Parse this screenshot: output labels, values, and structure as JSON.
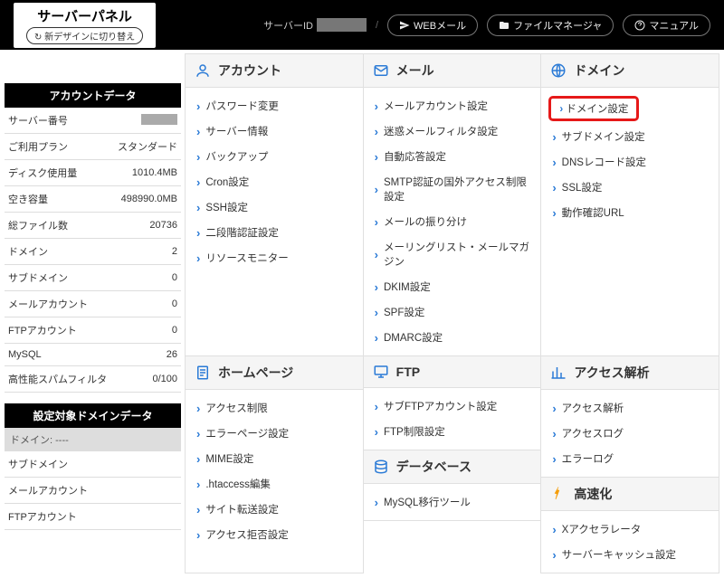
{
  "header": {
    "logo_title": "サーバーパネル",
    "switch_design": "新デザインに切り替え",
    "server_id_label": "サーバーID",
    "sep": "/",
    "webmail": "WEBメール",
    "filemanager": "ファイルマネージャ",
    "manual": "マニュアル"
  },
  "sidebar": {
    "account_title": "アカウントデータ",
    "rows": [
      {
        "label": "サーバー番号",
        "value": ""
      },
      {
        "label": "ご利用プラン",
        "value": "スタンダード"
      },
      {
        "label": "ディスク使用量",
        "value": "1010.4MB"
      },
      {
        "label": "空き容量",
        "value": "498990.0MB"
      },
      {
        "label": "総ファイル数",
        "value": "20736"
      },
      {
        "label": "ドメイン",
        "value": "2"
      },
      {
        "label": "サブドメイン",
        "value": "0"
      },
      {
        "label": "メールアカウント",
        "value": "0"
      },
      {
        "label": "FTPアカウント",
        "value": "0"
      },
      {
        "label": "MySQL",
        "value": "26"
      },
      {
        "label": "高性能スパムフィルタ",
        "value": "0/100"
      }
    ],
    "domain_title": "設定対象ドメインデータ",
    "domain_current": "ドメイン:  ----",
    "domain_rows": [
      {
        "label": "サブドメイン",
        "value": ""
      },
      {
        "label": "メールアカウント",
        "value": ""
      },
      {
        "label": "FTPアカウント",
        "value": ""
      }
    ]
  },
  "cats": {
    "account": {
      "title": "アカウント",
      "items": [
        "パスワード変更",
        "サーバー情報",
        "バックアップ",
        "Cron設定",
        "SSH設定",
        "二段階認証設定",
        "リソースモニター"
      ]
    },
    "mail": {
      "title": "メール",
      "items": [
        "メールアカウント設定",
        "迷惑メールフィルタ設定",
        "自動応答設定",
        "SMTP認証の国外アクセス制限設定",
        "メールの振り分け",
        "メーリングリスト・メールマガジン",
        "DKIM設定",
        "SPF設定",
        "DMARC設定"
      ]
    },
    "domain": {
      "title": "ドメイン",
      "items": [
        "ドメイン設定",
        "サブドメイン設定",
        "DNSレコード設定",
        "SSL設定",
        "動作確認URL"
      ]
    },
    "homepage": {
      "title": "ホームページ",
      "items": [
        "アクセス制限",
        "エラーページ設定",
        "MIME設定",
        ".htaccess編集",
        "サイト転送設定",
        "アクセス拒否設定"
      ]
    },
    "ftp": {
      "title": "FTP",
      "items": [
        "サブFTPアカウント設定",
        "FTP制限設定"
      ]
    },
    "access": {
      "title": "アクセス解析",
      "items": [
        "アクセス解析",
        "アクセスログ",
        "エラーログ"
      ]
    },
    "database": {
      "title": "データベース",
      "items": [
        "MySQL移行ツール"
      ]
    },
    "speed": {
      "title": "高速化",
      "items": [
        "Xアクセラレータ",
        "サーバーキャッシュ設定"
      ]
    }
  }
}
